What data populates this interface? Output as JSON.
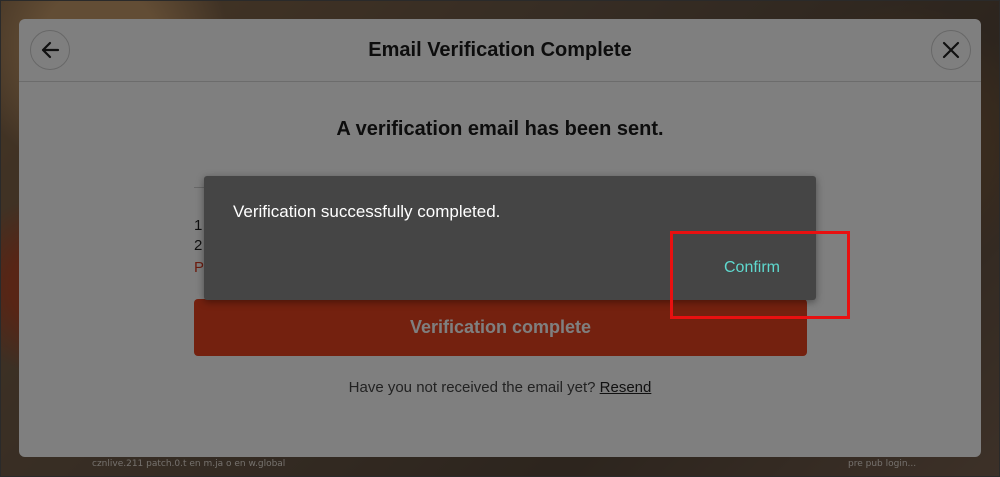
{
  "panel": {
    "title": "Email Verification Complete",
    "subtitle": "A verification email has been sent.",
    "partial_lines": [
      "1",
      "2",
      "P"
    ],
    "cta_label": "Verification complete",
    "resend_prompt": "Have you not received the email yet?",
    "resend_link": "Resend"
  },
  "dialog": {
    "message": "Verification successfully completed.",
    "confirm_label": "Confirm"
  },
  "footer": {
    "left": "cznlive.211 patch.0.t en m.ja o en w.global",
    "right": "pre pub login..."
  },
  "colors": {
    "accent": "#e8421f",
    "confirm": "#5fd9cf",
    "highlight": "#e81010"
  }
}
